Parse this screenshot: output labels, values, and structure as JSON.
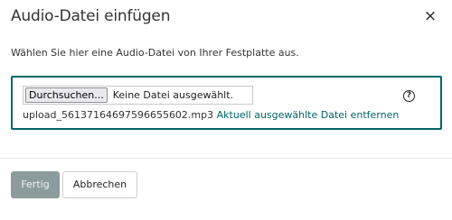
{
  "dialog": {
    "title": "Audio-Datei einfügen",
    "close_glyph": "×",
    "description": "Wählen Sie hier eine Audio-Datei von Ihrer Festplatte aus."
  },
  "upload": {
    "browse_label": "Durchsuchen...",
    "no_file_text": "Keine Datei ausgewählt.",
    "help_glyph": "?",
    "current_file": "upload_561371646975966556​02.mp3",
    "remove_link": "Aktuell ausgewählte Datei entfernen"
  },
  "footer": {
    "done_label": "Fertig",
    "cancel_label": "Abbrechen"
  },
  "colors": {
    "accent": "#006666",
    "done_button_bg": "#8c9b9b"
  },
  "icons": {
    "close": "close-icon",
    "help": "help-circle-icon"
  }
}
